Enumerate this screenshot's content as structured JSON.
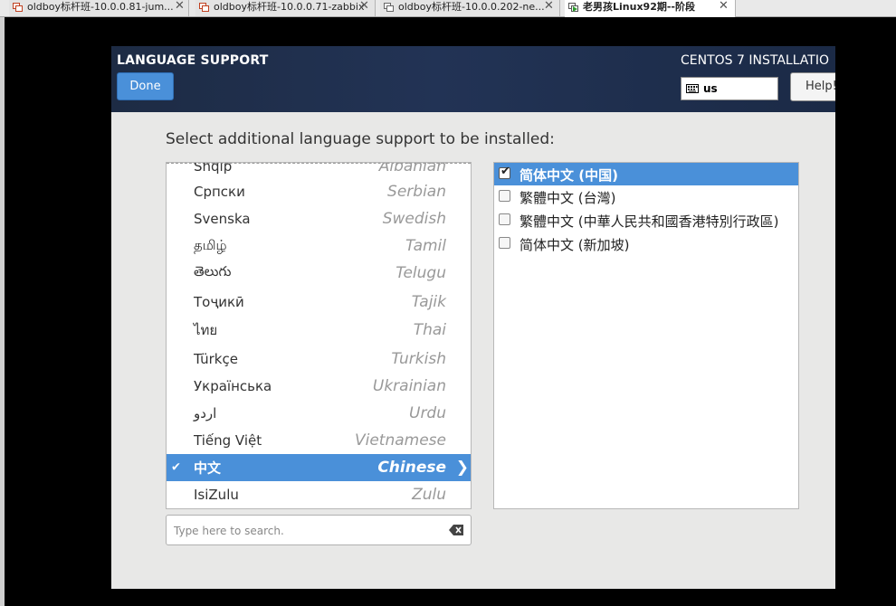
{
  "tabs": [
    {
      "title": "oldboy标杆班-10.0.0.81-jum...",
      "active": false
    },
    {
      "title": "oldboy标杆班-10.0.0.71-zabbix",
      "active": false
    },
    {
      "title": "oldboy标杆班-10.0.0.202-ne...",
      "active": false
    },
    {
      "title": "老男孩Linux92期--阶段",
      "active": true
    }
  ],
  "header": {
    "title": "LANGUAGE SUPPORT",
    "done_label": "Done",
    "product": "CENTOS 7 INSTALLATIO",
    "keyboard_layout": "us",
    "help_label": "Help!"
  },
  "prompt": "Select additional language support to be installed:",
  "languages": [
    {
      "native": "Shqip",
      "english": "Albanian"
    },
    {
      "native": "Српски",
      "english": "Serbian"
    },
    {
      "native": "Svenska",
      "english": "Swedish"
    },
    {
      "native": "தமிழ்",
      "english": "Tamil"
    },
    {
      "native": "తెలుగు",
      "english": "Telugu"
    },
    {
      "native": "Тоҷикӣ",
      "english": "Tajik"
    },
    {
      "native": "ไทย",
      "english": "Thai"
    },
    {
      "native": "Türkçe",
      "english": "Turkish"
    },
    {
      "native": "Українська",
      "english": "Ukrainian"
    },
    {
      "native": "اردو",
      "english": "Urdu"
    },
    {
      "native": "Tiếng Việt",
      "english": "Vietnamese"
    },
    {
      "native": "中文",
      "english": "Chinese",
      "selected": true
    },
    {
      "native": "IsiZulu",
      "english": "Zulu"
    }
  ],
  "locales": [
    {
      "label": "简体中文 (中国)",
      "checked": true
    },
    {
      "label": "繁體中文 (台灣)",
      "checked": false
    },
    {
      "label": "繁體中文 (中華人民共和國香港特別行政區)",
      "checked": false
    },
    {
      "label": "简体中文 (新加坡)",
      "checked": false
    }
  ],
  "search": {
    "placeholder": "Type here to search.",
    "value": ""
  }
}
